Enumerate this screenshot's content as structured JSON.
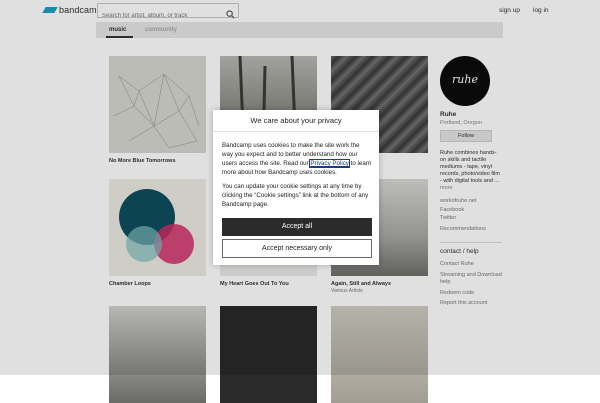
{
  "header": {
    "logo_text": "bandcamp",
    "search_placeholder": "Search for artist, album, or track",
    "signup_label": "sign up",
    "login_label": "log in"
  },
  "nav": {
    "tabs": [
      {
        "label": "music"
      },
      {
        "label": "community"
      }
    ]
  },
  "tiles": [
    {
      "title": "No More Blue Tomorrows",
      "artist": ""
    },
    {
      "title": "",
      "artist": ""
    },
    {
      "title": "",
      "artist": ""
    },
    {
      "title": "Chamber Loops",
      "artist": ""
    },
    {
      "title": "My Heart Goes Out To You",
      "artist": ""
    },
    {
      "title": "Again, Still and Always",
      "artist": "Various Artists"
    },
    {
      "title": "",
      "artist": ""
    },
    {
      "title": "",
      "artist": ""
    },
    {
      "title": "",
      "artist": ""
    }
  ],
  "sidebar": {
    "avatar_text": "ruhe",
    "band_name": "Ruhe",
    "location": "Portland, Oregon",
    "follow_label": "Follow",
    "bio": "Ruhe combines hands-on skills and tactile mediums - tape, vinyl records, photo/video film - with digital tools and ...",
    "bio_more": "more",
    "links": [
      "workofruhe.net",
      "Facebook",
      "Twitter",
      "Recommendations"
    ],
    "contact_heading": "contact / help",
    "contact_links": [
      "Contact Ruhe",
      "Streaming and Download help",
      "Redeem code",
      "Report this account"
    ]
  },
  "cookie_modal": {
    "title": "We care about your privacy",
    "paragraph1_before": "Bandcamp uses cookies to make the site work the way you expect and to better understand how our users access the site. Read our ",
    "privacy_link": "Privacy Policy",
    "paragraph1_after": " to learn more about how Bandcamp uses cookies.",
    "paragraph2": "You can update your cookie settings at any time by clicking the “Cookie settings” link at the bottom of any Bandcamp page.",
    "accept_all_label": "Accept all",
    "accept_necessary_label": "Accept necessary only"
  },
  "colors": {
    "logo_accent": "#1da0c3",
    "accept_button": "#2b2b2b",
    "overlay": "rgba(0,0,0,0.12)"
  }
}
